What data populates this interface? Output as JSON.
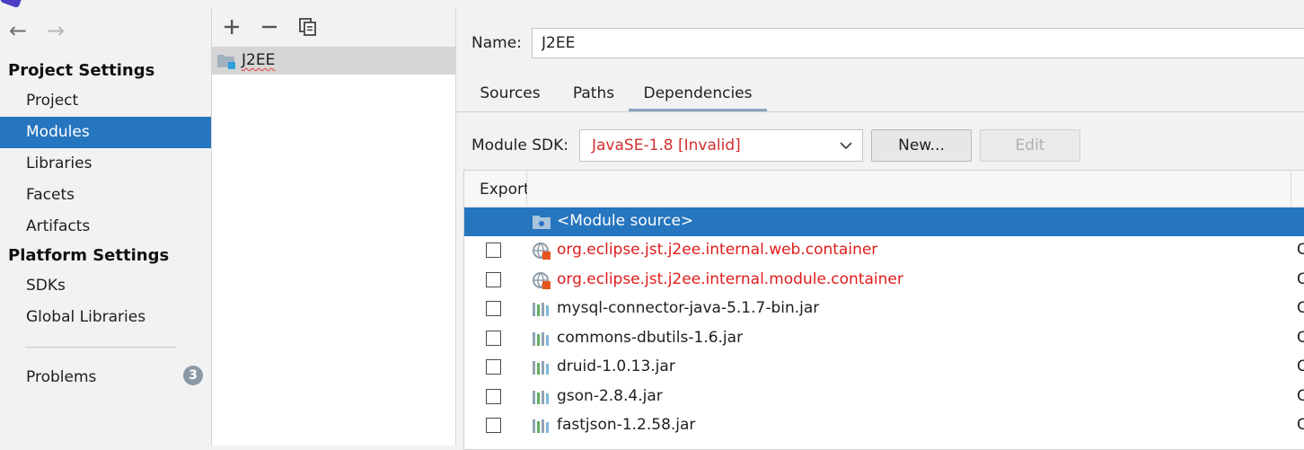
{
  "nav": {
    "back_icon": "arrow-left-icon",
    "forward_icon": "arrow-right-icon",
    "project_settings_header": "Project Settings",
    "project_items": [
      {
        "label": "Project"
      },
      {
        "label": "Modules"
      },
      {
        "label": "Libraries"
      },
      {
        "label": "Facets"
      },
      {
        "label": "Artifacts"
      }
    ],
    "platform_settings_header": "Platform Settings",
    "platform_items": [
      {
        "label": "SDKs"
      },
      {
        "label": "Global Libraries"
      }
    ],
    "problems_label": "Problems",
    "problems_count": "3"
  },
  "modules": {
    "toolbar_icons": [
      "add-icon",
      "remove-icon",
      "copy-icon"
    ],
    "items": [
      {
        "name": "J2EE"
      }
    ]
  },
  "detail": {
    "name_label": "Name:",
    "name_value": "J2EE",
    "tabs": [
      {
        "label": "Sources"
      },
      {
        "label": "Paths"
      },
      {
        "label": "Dependencies"
      }
    ],
    "active_tab": "Dependencies",
    "sdk_label": "Module SDK:",
    "sdk_value": "JavaSE-1.8 [Invalid]",
    "new_button": "New...",
    "edit_button": "Edit",
    "table": {
      "export_header": "Export",
      "rows": [
        {
          "label": "<Module source>",
          "type": "module-source",
          "selected": true,
          "error": false,
          "scope": ""
        },
        {
          "label": "org.eclipse.jst.j2ee.internal.web.container",
          "type": "container",
          "selected": false,
          "error": true,
          "scope": "C"
        },
        {
          "label": "org.eclipse.jst.j2ee.internal.module.container",
          "type": "container",
          "selected": false,
          "error": true,
          "scope": "C"
        },
        {
          "label": "mysql-connector-java-5.1.7-bin.jar",
          "type": "library",
          "selected": false,
          "error": false,
          "scope": "C"
        },
        {
          "label": "commons-dbutils-1.6.jar",
          "type": "library",
          "selected": false,
          "error": false,
          "scope": "C"
        },
        {
          "label": "druid-1.0.13.jar",
          "type": "library",
          "selected": false,
          "error": false,
          "scope": "C"
        },
        {
          "label": "gson-2.8.4.jar",
          "type": "library",
          "selected": false,
          "error": false,
          "scope": "C"
        },
        {
          "label": "fastjson-1.2.58.jar",
          "type": "library",
          "selected": false,
          "error": false,
          "scope": "C"
        }
      ]
    }
  },
  "colors": {
    "selection": "#2675bf",
    "error_text": "#e01b1b",
    "badge": "#8c99a6"
  }
}
